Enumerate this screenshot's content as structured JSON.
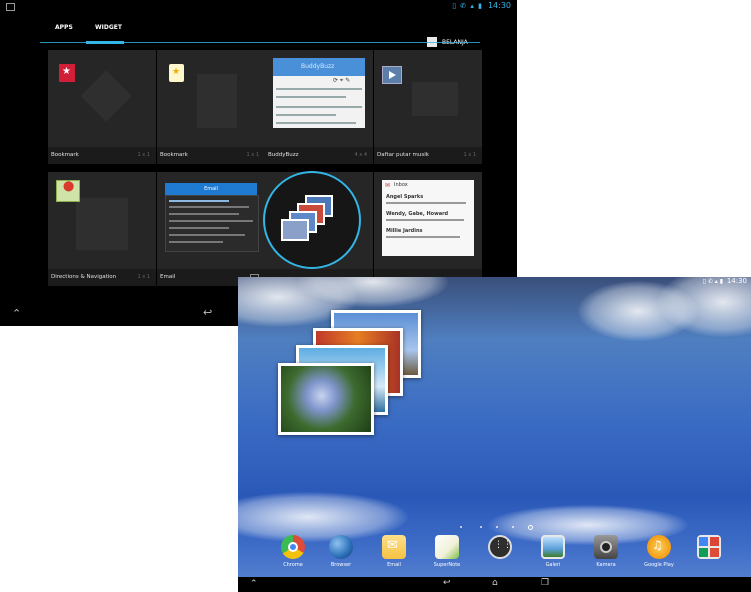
{
  "screen1": {
    "status": {
      "time": "14:30",
      "icons": "▯ ✆ ▴ ▮"
    },
    "tabs": [
      {
        "label": "APPS"
      },
      {
        "label": "WIDGET"
      }
    ],
    "shop_label": "BELANJA",
    "widgets": [
      {
        "name": "Bookmark",
        "size": "1 x 1"
      },
      {
        "name": "Bookmark",
        "size": "1 x 1"
      },
      {
        "name": "BuddyBuzz",
        "size": "4 x 4"
      },
      {
        "name": "Daftar putar musik",
        "size": "1 x 1"
      },
      {
        "name": "Directions & Navigation",
        "size": "1 x 1"
      },
      {
        "name": "Email",
        "size": ""
      },
      {
        "name": "",
        "size": ""
      },
      {
        "name": "",
        "size": ""
      }
    ],
    "buddybuzz_header": "BuddyBuzz",
    "email_header": "Email",
    "gmail_sender": "Inbox",
    "gmail_items": [
      "Angel Sparks",
      "Wendy, Gabe, Howard",
      "Millie Jardins"
    ]
  },
  "screen2": {
    "status": {
      "time": "14:30",
      "icons": "▯ ✆ ▴ ▮"
    },
    "dock": [
      {
        "label": "Chrome",
        "icon": "chrome-icon",
        "color": "#dd4b39"
      },
      {
        "label": "Browser",
        "icon": "globe-icon",
        "color": "#2a6fb8"
      },
      {
        "label": "Email",
        "icon": "email-icon",
        "color": "#f5c242"
      },
      {
        "label": "SuperNote",
        "icon": "notepad-icon",
        "color": "#7fbf3f"
      },
      {
        "label": "",
        "icon": "all-apps-icon",
        "color": "#2e2e2e"
      },
      {
        "label": "Galeri",
        "icon": "gallery-icon",
        "color": "#5aa0d8"
      },
      {
        "label": "Kamera",
        "icon": "camera-icon",
        "color": "#555555"
      },
      {
        "label": "Google Play",
        "icon": "headphones-icon",
        "color": "#f39c12"
      },
      {
        "label": "",
        "icon": "google-apps-folder-icon",
        "color": "#e8e8e8"
      }
    ]
  },
  "colors": {
    "accent": "#33b5e5"
  }
}
